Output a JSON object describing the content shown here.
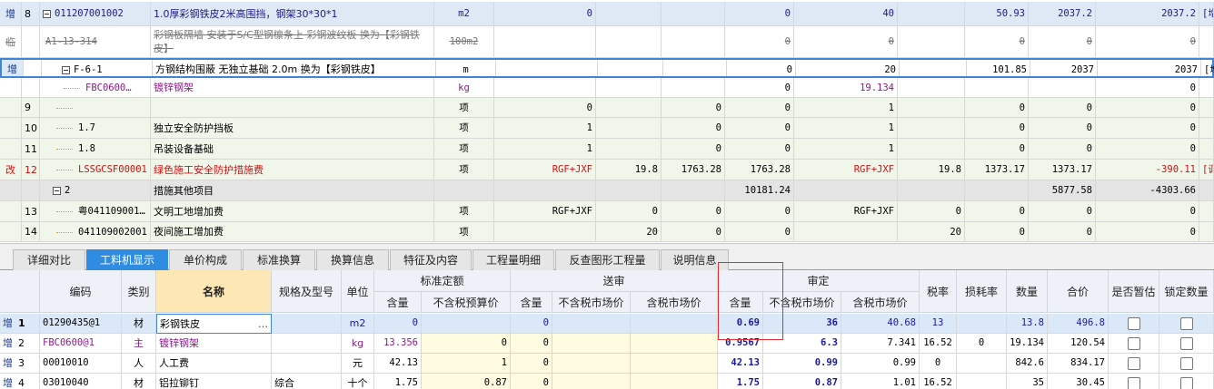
{
  "upper_rows": [
    {
      "flag": "增",
      "no": "8",
      "code": "011207001002",
      "name": "1.0厚彩钢铁皮2米高围挡，钢架30*30*1",
      "unit": "m2",
      "c1": "0",
      "c2": "",
      "c3": "",
      "c4": "0",
      "c5": "40",
      "c6": "",
      "c7": "50.93",
      "c8": "2037.2",
      "c9": "2037.2",
      "c10": "[增"
    },
    {
      "flag": "临",
      "no": "",
      "code": "A1-13-314",
      "name": "彩钢板隔墙 安装于S/C型钢檩条上 彩钢波纹板  换为【彩钢铁皮】",
      "unit": "100m2",
      "c1": "",
      "c2": "",
      "c3": "",
      "c4": "0",
      "c5": "0",
      "c6": "",
      "c7": "0",
      "c8": "0",
      "c9": "0",
      "c10": ""
    },
    {
      "flag": "增",
      "no": "",
      "code": "F-6-1",
      "name": "方钢结构围蔽 无独立基础 2.0m   换为【彩钢铁皮】",
      "unit": "m",
      "c1": "",
      "c2": "",
      "c3": "",
      "c4": "0",
      "c5": "20",
      "c6": "",
      "c7": "101.85",
      "c8": "2037",
      "c9": "2037",
      "c10": "[增"
    },
    {
      "flag": "",
      "no": "",
      "code": "FBC0600…",
      "name": "镀锌钢架",
      "unit": "kg",
      "c1": "",
      "c2": "",
      "c3": "",
      "c4": "0",
      "c5": "19.134",
      "c6": "",
      "c7": "",
      "c8": "",
      "c9": "0",
      "c10": ""
    },
    {
      "flag": "",
      "no": "9",
      "code": "",
      "name": "",
      "unit": "项",
      "c1": "0",
      "c2": "",
      "c3": "0",
      "c4": "0",
      "c5": "1",
      "c6": "",
      "c7": "0",
      "c8": "0",
      "c9": "0",
      "c10": ""
    },
    {
      "flag": "",
      "no": "10",
      "code": "1.7",
      "name": "独立安全防护挡板",
      "unit": "项",
      "c1": "1",
      "c2": "",
      "c3": "0",
      "c4": "0",
      "c5": "1",
      "c6": "",
      "c7": "0",
      "c8": "0",
      "c9": "0",
      "c10": ""
    },
    {
      "flag": "",
      "no": "11",
      "code": "1.8",
      "name": "吊装设备基础",
      "unit": "项",
      "c1": "1",
      "c2": "",
      "c3": "0",
      "c4": "0",
      "c5": "1",
      "c6": "",
      "c7": "0",
      "c8": "0",
      "c9": "0",
      "c10": ""
    },
    {
      "flag": "改",
      "no": "12",
      "code": "LSSGCSF00001",
      "name": "绿色施工安全防护措施费",
      "unit": "项",
      "c1": "RGF+JXF",
      "c2": "19.8",
      "c3": "1763.28",
      "c4": "1763.28",
      "c5": "RGF+JXF",
      "c6": "19.8",
      "c7": "1373.17",
      "c8": "1373.17",
      "c9": "-390.11",
      "c10": "[调"
    },
    {
      "flag": "",
      "no": "",
      "code": "2",
      "name": "措施其他项目",
      "unit": "",
      "c1": "",
      "c2": "",
      "c3": "",
      "c4": "10181.24",
      "c5": "",
      "c6": "",
      "c7": "",
      "c8": "5877.58",
      "c9": "-4303.66",
      "c10": ""
    },
    {
      "flag": "",
      "no": "13",
      "code": "粤041109001…",
      "name": "文明工地增加费",
      "unit": "项",
      "c1": "RGF+JXF",
      "c2": "0",
      "c3": "0",
      "c4": "0",
      "c5": "RGF+JXF",
      "c6": "0",
      "c7": "0",
      "c8": "0",
      "c9": "0",
      "c10": ""
    },
    {
      "flag": "",
      "no": "14",
      "code": "041109002001",
      "name": "夜间施工增加费",
      "unit": "项",
      "c1": "",
      "c2": "20",
      "c3": "0",
      "c4": "0",
      "c5": "",
      "c6": "20",
      "c7": "0",
      "c8": "0",
      "c9": "0",
      "c10": ""
    }
  ],
  "tabs": [
    "详细对比",
    "工料机显示",
    "单价构成",
    "标准换算",
    "换算信息",
    "特征及内容",
    "工程量明细",
    "反查图形工程量",
    "说明信息"
  ],
  "active_tab": 1,
  "lower_header": {
    "code": "编码",
    "type": "类别",
    "name": "名称",
    "spec": "规格及型号",
    "unit": "单位",
    "std_group": "标准定额",
    "std_qty": "含量",
    "std_price": "不含税预算价",
    "send_group": "送审",
    "send_qty": "含量",
    "send_price_ex": "不含税市场价",
    "send_price_in": "含税市场价",
    "aud_group": "审定",
    "aud_qty": "含量",
    "aud_price_ex": "不含税市场价",
    "aud_price_in": "含税市场价",
    "tax": "税率",
    "loss": "损耗率",
    "qty": "数量",
    "total": "合价",
    "provisional": "是否暂估",
    "lock": "锁定数量"
  },
  "lower_rows": [
    {
      "flag": "增",
      "no": "1",
      "code": "01290435@1",
      "type": "材",
      "name": "彩钢铁皮",
      "spec": "",
      "unit": "m2",
      "std_qty": "0",
      "std_price": "",
      "send_qty": "0",
      "send_ex": "",
      "send_in": "",
      "aud_qty": "0.69",
      "aud_ex": "36",
      "aud_in": "40.68",
      "tax": "13",
      "loss": "",
      "qty": "13.8",
      "total": "496.8"
    },
    {
      "flag": "增",
      "no": "2",
      "code": "FBC0600@1",
      "type": "主",
      "name": "镀锌钢架",
      "spec": "",
      "unit": "kg",
      "std_qty": "13.356",
      "std_price": "0",
      "send_qty": "0",
      "send_ex": "",
      "send_in": "",
      "aud_qty": "0.9567",
      "aud_ex": "6.3",
      "aud_in": "7.341",
      "tax": "16.52",
      "loss": "0",
      "qty": "19.134",
      "total": "120.54"
    },
    {
      "flag": "增",
      "no": "3",
      "code": "00010010",
      "type": "人",
      "name": "人工费",
      "spec": "",
      "unit": "元",
      "std_qty": "42.13",
      "std_price": "1",
      "send_qty": "0",
      "send_ex": "",
      "send_in": "",
      "aud_qty": "42.13",
      "aud_ex": "0.99",
      "aud_in": "0.99",
      "tax": "0",
      "loss": "",
      "qty": "842.6",
      "total": "834.17"
    },
    {
      "flag": "增",
      "no": "4",
      "code": "03010040",
      "type": "材",
      "name": "铝拉铆钉",
      "spec": "综合",
      "unit": "十个",
      "std_qty": "1.75",
      "std_price": "0.87",
      "send_qty": "0",
      "send_ex": "",
      "send_in": "",
      "aud_qty": "1.75",
      "aud_ex": "0.87",
      "aud_in": "1.01",
      "tax": "16.52",
      "loss": "",
      "qty": "35",
      "total": "30.45"
    }
  ],
  "colors": {
    "accent": "#2f8ce0",
    "highlight_box": "#e03030",
    "added_row_bg": "#eef6e8",
    "changed_text": "#d01010",
    "material_text": "#8a1a8a",
    "value_blue": "#1a1aa0"
  }
}
